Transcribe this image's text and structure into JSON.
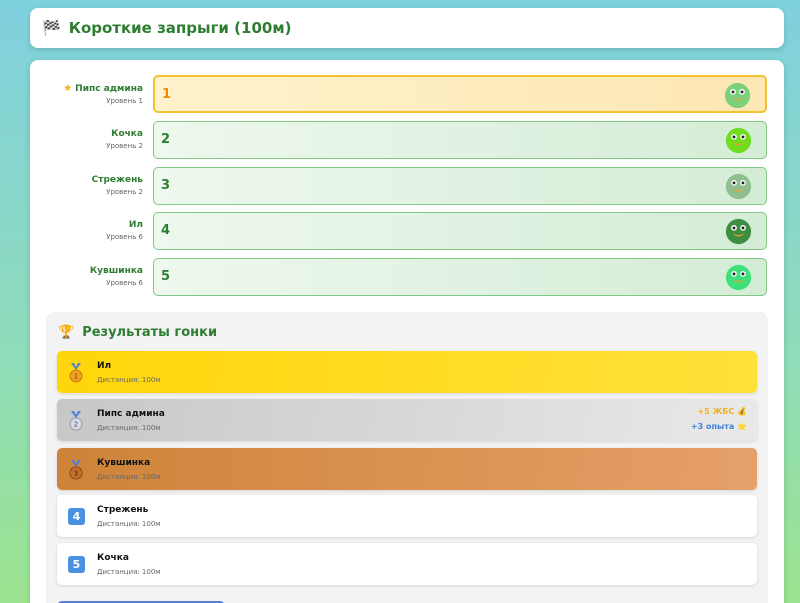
{
  "header": {
    "title": "Короткие запрыги (100м)",
    "icon": "checkered-flag-icon"
  },
  "lanes": [
    {
      "name": "Пипс админа",
      "level": "Уровень 1",
      "number": "1",
      "highlight": true,
      "frog_color": "#7bd07b"
    },
    {
      "name": "Кочка",
      "level": "Уровень 2",
      "number": "2",
      "highlight": false,
      "frog_color": "#6fdc1e"
    },
    {
      "name": "Стрежень",
      "level": "Уровень 2",
      "number": "3",
      "highlight": false,
      "frog_color": "#8fbf8f"
    },
    {
      "name": "Ил",
      "level": "Уровень 6",
      "number": "4",
      "highlight": false,
      "frog_color": "#3e8e41"
    },
    {
      "name": "Кувшинка",
      "level": "Уровень 6",
      "number": "5",
      "highlight": false,
      "frog_color": "#3ee07a"
    }
  ],
  "results": {
    "title": "Результаты гонки",
    "items": [
      {
        "name": "Ил",
        "distance": "Дистанция: 100м"
      },
      {
        "name": "Пипс админа",
        "distance": "Дистанция: 100м",
        "coins": "+5 ЖБС 💰",
        "xp": "+3 опыта ⭐"
      },
      {
        "name": "Кувшинка",
        "distance": "Дистанция: 100м"
      },
      {
        "name": "Стрежень",
        "distance": "Дистанция: 100м",
        "badge": "4"
      },
      {
        "name": "Кочка",
        "distance": "Дистанция: 100м",
        "badge": "5"
      }
    ]
  }
}
